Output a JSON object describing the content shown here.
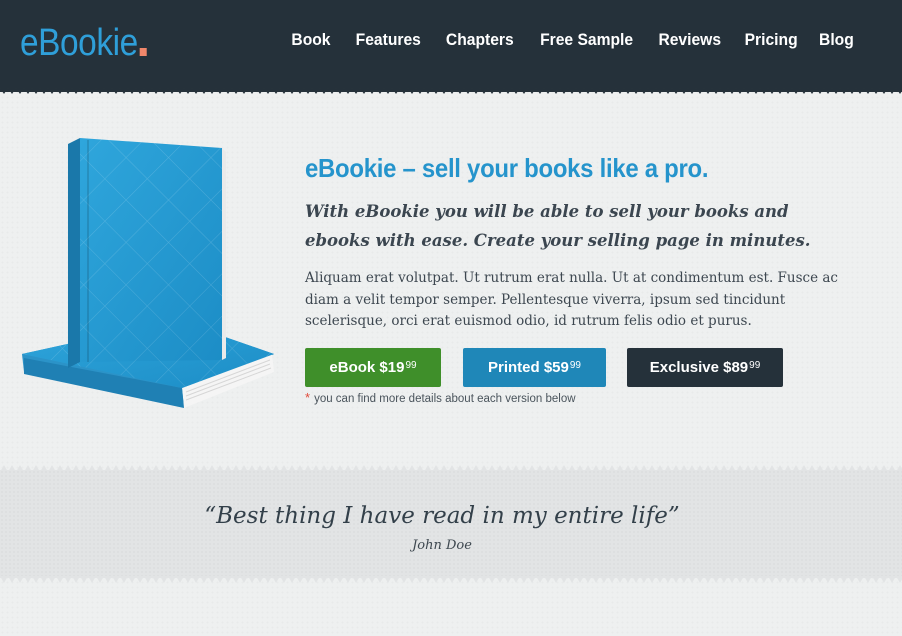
{
  "brand": {
    "logo": "eBookie",
    "accent_color": "#2f9fd9",
    "dot_color": "#f0876b",
    "header_bg": "#25313a"
  },
  "nav": {
    "items": [
      {
        "label": "Book"
      },
      {
        "label": "Features"
      },
      {
        "label": "Chapters"
      },
      {
        "label": "Free Sample"
      },
      {
        "label": "Reviews"
      },
      {
        "label": "Pricing"
      },
      {
        "label": "Blog"
      }
    ]
  },
  "hero": {
    "title": "eBookie – sell your books like a pro.",
    "subtitle": "With eBookie you will be able to sell your books and ebooks with ease. Create your selling page in minutes.",
    "body": "Aliquam erat volutpat. Ut rutrum erat nulla. Ut at condimentum est. Fusce ac diam a velit tempor semper. Pellentesque viverra, ipsum sed tincidunt scelerisque, orci erat euismod odio, id rutrum felis odio et purus.",
    "book_image": "blue-book-icon"
  },
  "buttons": [
    {
      "label": "eBook $19",
      "cents": "99",
      "color": "#3f8f2a"
    },
    {
      "label": "Printed $59",
      "cents": "99",
      "color": "#1f87b8"
    },
    {
      "label": "Exclusive $89",
      "cents": "99",
      "color": "#25313a"
    }
  ],
  "footnote": {
    "star": "*",
    "text": "you can find more details about each version below"
  },
  "testimonial": {
    "quote": "“Best thing I have read in my entire life”",
    "author": "John Doe"
  }
}
